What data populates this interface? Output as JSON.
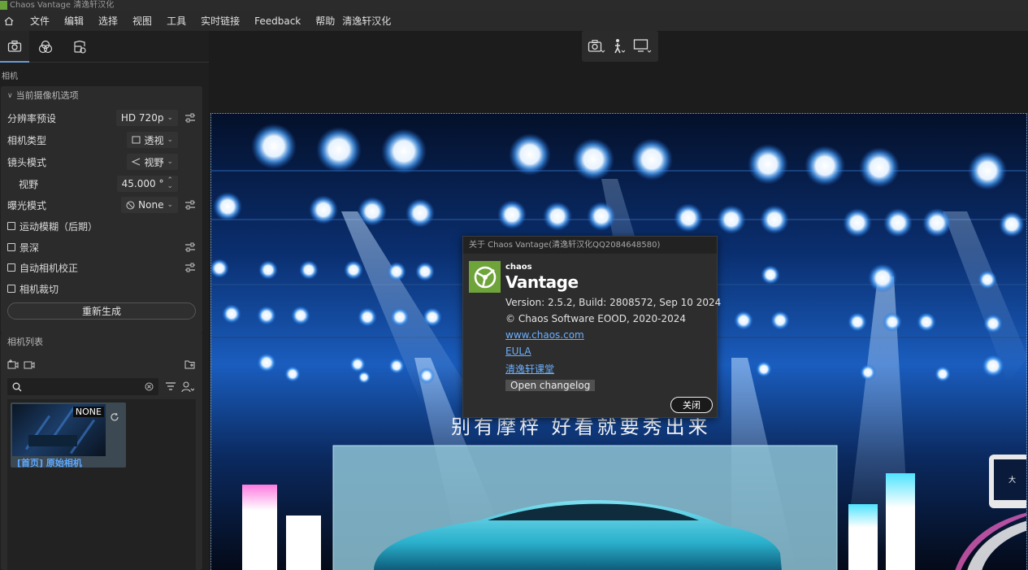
{
  "window": {
    "title": "Chaos Vantage 清逸轩汉化"
  },
  "menu": {
    "items": [
      "文件",
      "编辑",
      "选择",
      "视图",
      "工具",
      "实时链接",
      "Feedback",
      "帮助",
      "清逸轩汉化"
    ]
  },
  "left_panel": {
    "section_label": "相机",
    "camera_options": {
      "header": "当前摄像机选项",
      "rows": [
        {
          "label": "分辨率预设",
          "value": "HD 720p"
        },
        {
          "label": "相机类型",
          "value": "透视"
        },
        {
          "label": "镜头模式",
          "value": "视野"
        },
        {
          "label": "视野",
          "value": "45.000 °"
        },
        {
          "label": "曝光模式",
          "value": "None"
        }
      ],
      "checkboxes": [
        "运动模糊（后期）",
        "景深",
        "自动相机校正",
        "相机裁切"
      ],
      "regenerate_label": "重新生成"
    },
    "camera_list": {
      "header": "相机列表",
      "search_placeholder": "",
      "cameras": [
        {
          "badge": "NONE",
          "name": "[首页] 原始相机"
        }
      ]
    }
  },
  "scene": {
    "slogan": "别有摩梓 好看就要秀出来",
    "callout_text": "大"
  },
  "about_dialog": {
    "title": "关于 Chaos Vantage(清逸轩汉化QQ2084648580)",
    "brand_small": "chaos",
    "brand": "Vantage",
    "version": "Version: 2.5.2, Build: 2808572, Sep 10 2024",
    "copyright": "© Chaos Software EOOD, 2020-2024",
    "links": [
      "www.chaos.com",
      "EULA",
      "清逸轩课堂"
    ],
    "changelog_label": "Open changelog",
    "close_label": "关闭"
  },
  "colors": {
    "accent": "#6a9ad8",
    "link": "#6ab0ff",
    "brand_green": "#6fa43a"
  }
}
